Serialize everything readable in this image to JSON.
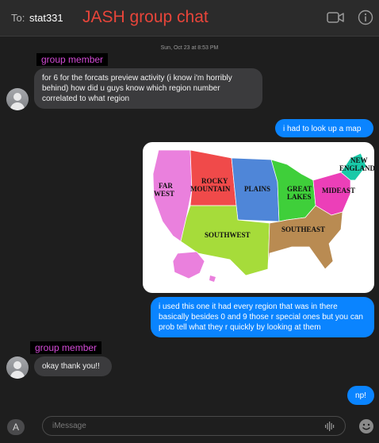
{
  "header": {
    "to_label": "To:",
    "recipient": "stat331",
    "chat_title": "JASH group chat",
    "icons": [
      "video-camera-icon",
      "info-icon"
    ]
  },
  "timestamp": "Sun, Oct 23 at 8:53 PM",
  "messages": [
    {
      "sender": "group member",
      "direction": "incoming",
      "text": "for 6 for the forcats preview activity (i know i'm horribly behind) how did u guys know which region number correlated to what region"
    },
    {
      "direction": "outgoing",
      "text": "i had to look up a map"
    },
    {
      "direction": "outgoing",
      "type": "image",
      "image_description_labels": [
        "FAR WEST",
        "ROCKY MOUNTAIN",
        "PLAINS",
        "GREAT LAKES",
        "MIDEAST",
        "NEW ENGLAND",
        "SOUTHWEST",
        "SOUTHEAST"
      ]
    },
    {
      "direction": "outgoing",
      "text": "i used this one it had every region that was in there basically besides 0 and 9 those r special ones but you can prob tell what they r quickly by looking at them"
    },
    {
      "sender": "group member",
      "direction": "incoming",
      "text": "okay thank you!!"
    },
    {
      "direction": "outgoing",
      "text": "np!"
    }
  ],
  "map": {
    "far_west": "FAR\nWEST",
    "rocky_mountain": "ROCKY\nMOUNTAIN",
    "plains": "PLAINS",
    "great_lakes": "GREAT\nLAKES",
    "mideast": "MIDEAST",
    "new_england": "NEW\nENGLAND",
    "southwest": "SOUTHWEST",
    "southeast": "SOUTHEAST",
    "colors": {
      "far_west": "#ea80dd",
      "rocky_mountain": "#f04a4a",
      "plains": "#4f86d8",
      "great_lakes": "#3fcf3a",
      "mideast": "#ec3fb8",
      "new_england": "#19c9a8",
      "southwest": "#a6dc3a",
      "southeast": "#b98b52"
    }
  },
  "composer": {
    "placeholder": "iMessage",
    "icons": [
      "app-store-icon",
      "audio-waveform-icon",
      "emoji-icon"
    ]
  },
  "colors": {
    "title": "#e8453a",
    "sender_tag": "#d34ad6",
    "outgoing_bubble": "#0a84ff",
    "incoming_bubble": "#3b3b3d",
    "background": "#1e1e1e"
  }
}
